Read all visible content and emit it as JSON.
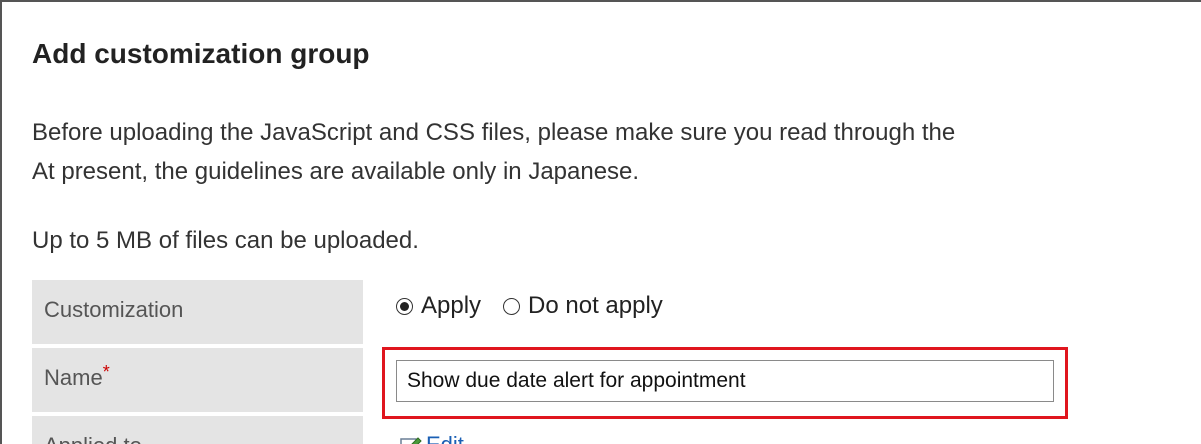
{
  "page": {
    "title": "Add customization group",
    "description_line1": "Before uploading the JavaScript and CSS files, please make sure you read through the",
    "description_line2": "At present, the guidelines are available only in Japanese.",
    "upload_limit": "Up to 5 MB of files can be uploaded."
  },
  "form": {
    "customization": {
      "label": "Customization",
      "options": [
        {
          "label": "Apply",
          "selected": true
        },
        {
          "label": "Do not apply",
          "selected": false
        }
      ]
    },
    "name": {
      "label": "Name",
      "required_mark": "*",
      "value": "Show due date alert for appointment"
    },
    "applied_to": {
      "label": "Applied to",
      "action_label": "Edit",
      "action_icon": "edit-icon"
    }
  },
  "colors": {
    "highlight": "#e0161e",
    "label_bg": "#e4e4e4",
    "link": "#1a5fb4",
    "required": "#cc0000"
  }
}
